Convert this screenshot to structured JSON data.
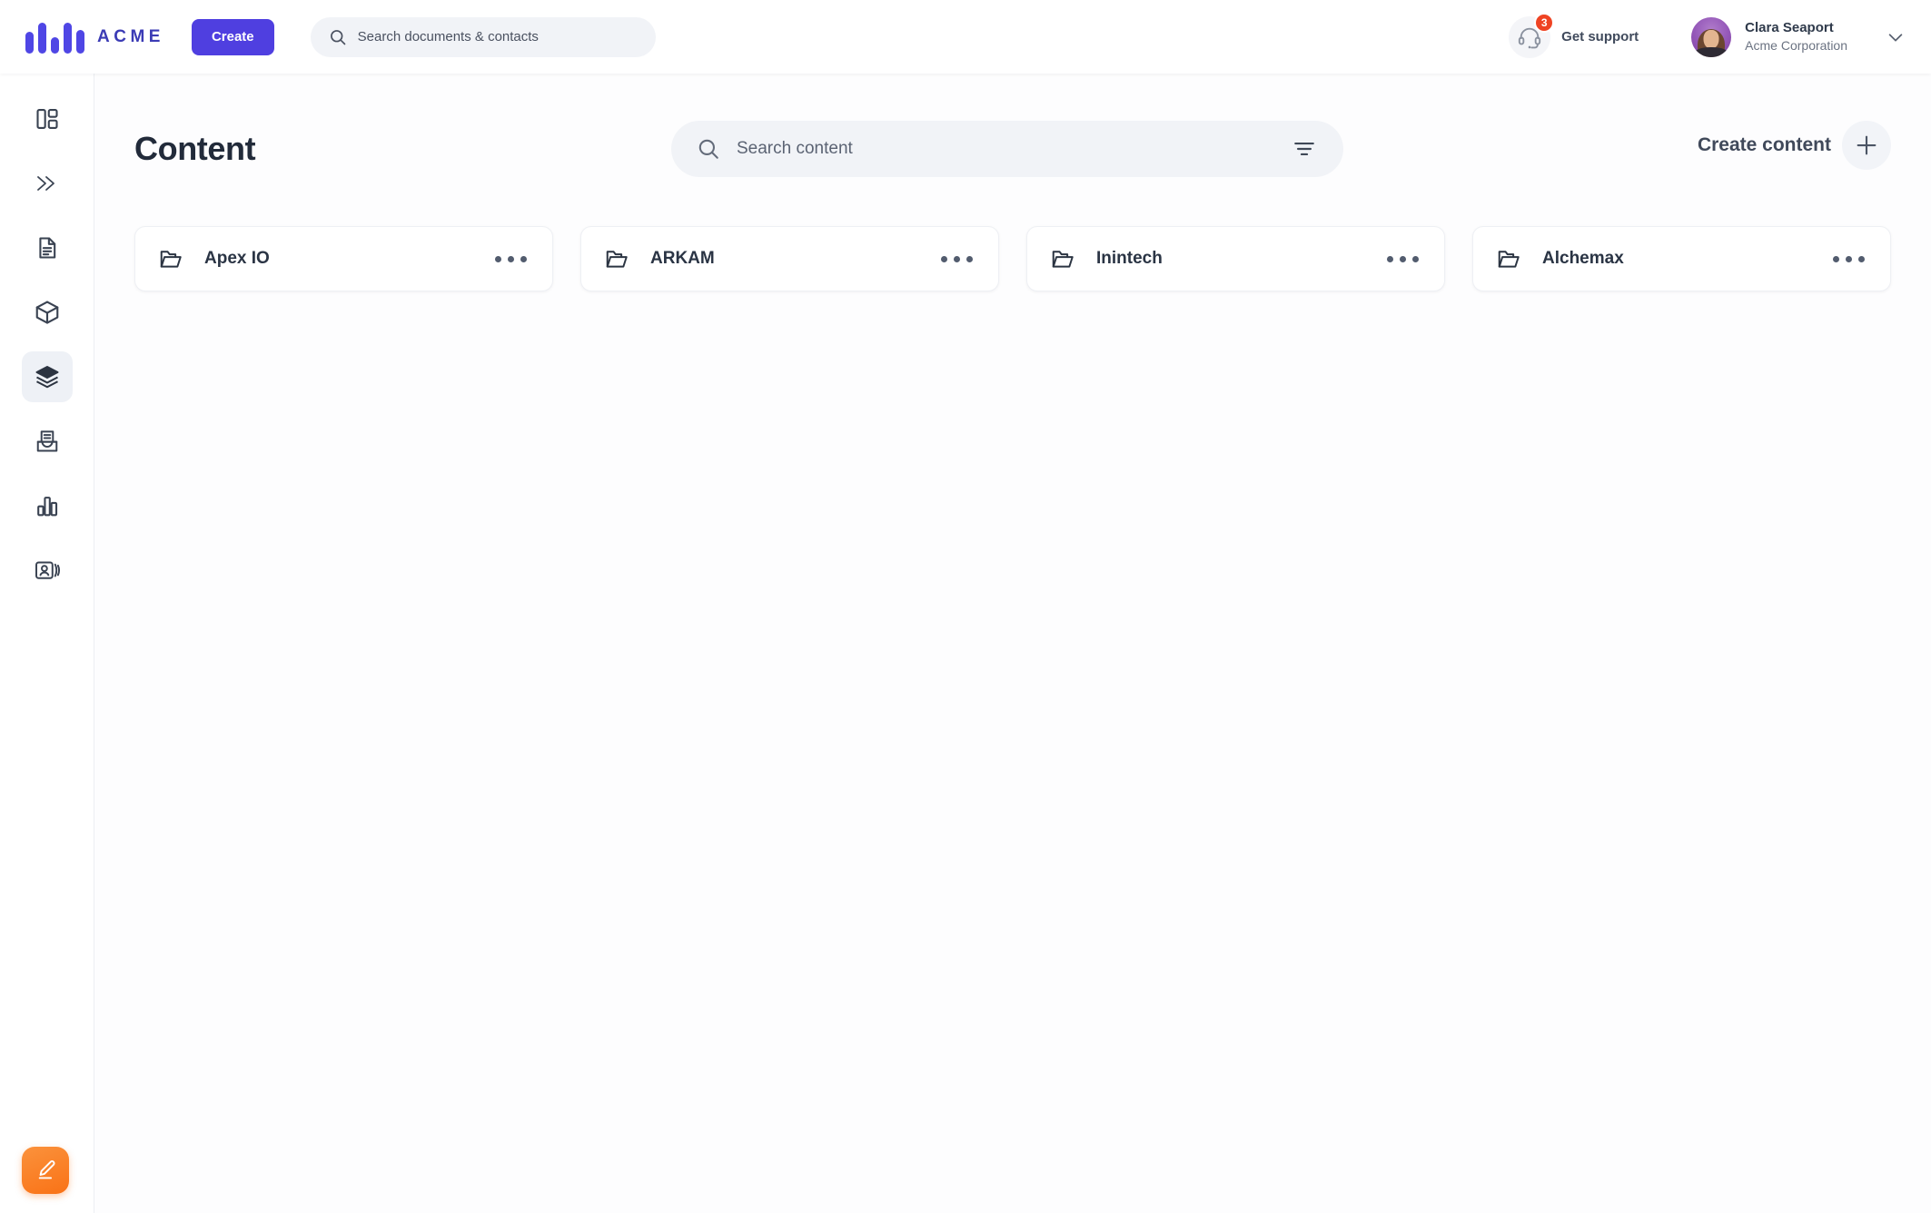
{
  "brand": {
    "name": "ACME",
    "logo_icon": "acme-bars-logo",
    "accent_color": "#4f46e5"
  },
  "topbar": {
    "create_label": "Create",
    "search": {
      "placeholder": "Search documents & contacts",
      "value": "",
      "icon": "search-icon"
    },
    "support": {
      "label": "Get support",
      "icon": "headset-icon",
      "badge_count": "3",
      "badge_color": "#ef4323"
    },
    "user": {
      "name": "Clara Seaport",
      "org": "Acme Corporation",
      "avatar_icon": "user-avatar",
      "chevron_icon": "chevron-down-icon"
    }
  },
  "sidebar": {
    "items": [
      {
        "name": "dashboard",
        "icon": "dashboard-layout-icon",
        "active": false
      },
      {
        "name": "pipelines",
        "icon": "double-chevron-right-icon",
        "active": false
      },
      {
        "name": "documents",
        "icon": "document-icon",
        "active": false
      },
      {
        "name": "products",
        "icon": "cube-box-icon",
        "active": false
      },
      {
        "name": "content",
        "icon": "layers-stack-icon",
        "active": true
      },
      {
        "name": "inbox",
        "icon": "inbox-tray-icon",
        "active": false
      },
      {
        "name": "analytics",
        "icon": "bar-chart-icon",
        "active": false
      },
      {
        "name": "contacts",
        "icon": "contact-card-icon",
        "active": false
      }
    ],
    "compose_button": {
      "icon": "pencil-edit-icon",
      "color": "#f97216"
    }
  },
  "main": {
    "page_title": "Content",
    "search": {
      "placeholder": "Search content",
      "value": "",
      "icon": "search-icon",
      "filter_icon": "filter-lines-icon"
    },
    "create_content": {
      "label": "Create content",
      "icon": "plus-icon"
    },
    "folders": [
      {
        "name": "Apex IO",
        "icon": "open-folder-icon",
        "menu_icon": "more-horizontal-icon"
      },
      {
        "name": "ARKAM",
        "icon": "open-folder-icon",
        "menu_icon": "more-horizontal-icon"
      },
      {
        "name": "Inintech",
        "icon": "open-folder-icon",
        "menu_icon": "more-horizontal-icon"
      },
      {
        "name": "Alchemax",
        "icon": "open-folder-icon",
        "menu_icon": "more-horizontal-icon"
      }
    ]
  }
}
